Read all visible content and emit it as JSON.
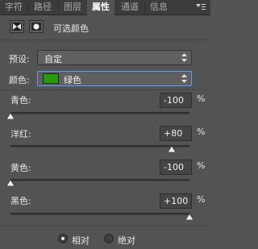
{
  "tabs": [
    "字符",
    "路径",
    "图层",
    "属性",
    "通道",
    "信息"
  ],
  "active_tab": "属性",
  "panel_title": "可选颜色",
  "preset": {
    "label": "预设:",
    "value": "自定"
  },
  "colors": {
    "label": "颜色:",
    "value": "绿色",
    "swatch": "#2a9a0d"
  },
  "sliders": [
    {
      "label": "青色:",
      "value": "-100",
      "unit": "%",
      "level": -100
    },
    {
      "label": "洋红:",
      "value": "+80",
      "unit": "%",
      "level": 80
    },
    {
      "label": "黄色:",
      "value": "-100",
      "unit": "%",
      "level": -100
    },
    {
      "label": "黑色:",
      "value": "+100",
      "unit": "%",
      "level": 100
    }
  ],
  "method": {
    "options": [
      "相对",
      "绝对"
    ],
    "selected": "相对"
  },
  "colors_palette": {
    "panel_bg": "#535353",
    "tab_bg": "#3c3c3c",
    "focus": "#7a9cc9"
  }
}
